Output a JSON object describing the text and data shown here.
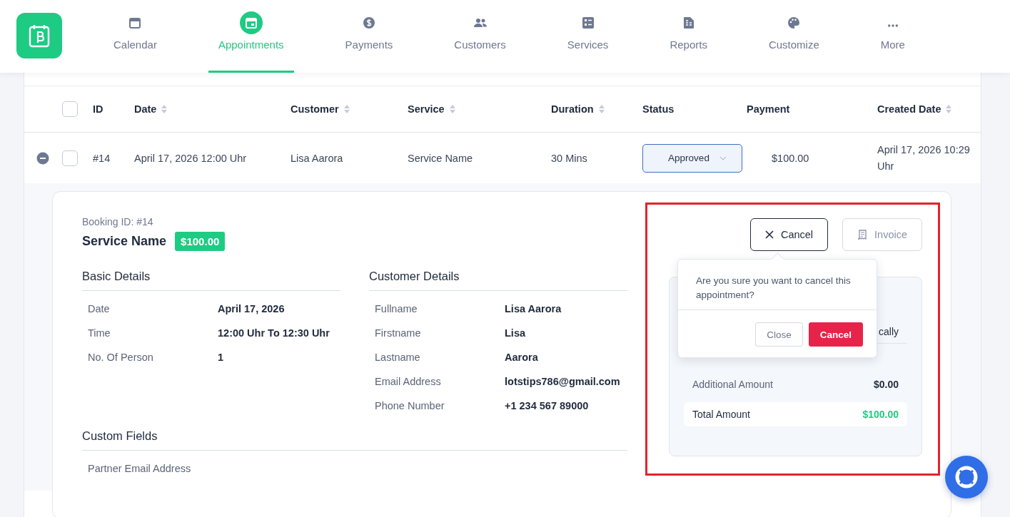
{
  "nav": {
    "items": [
      {
        "label": "Calendar",
        "selected": false
      },
      {
        "label": "Appointments",
        "selected": true
      },
      {
        "label": "Payments",
        "selected": false
      },
      {
        "label": "Customers",
        "selected": false
      },
      {
        "label": "Services",
        "selected": false
      },
      {
        "label": "Reports",
        "selected": false
      },
      {
        "label": "Customize",
        "selected": false
      },
      {
        "label": "More",
        "selected": false
      }
    ]
  },
  "table": {
    "select_all_checked": false,
    "columns": [
      {
        "label": "ID",
        "sortable": false
      },
      {
        "label": "Date",
        "sortable": true
      },
      {
        "label": "Customer",
        "sortable": true
      },
      {
        "label": "Service",
        "sortable": true
      },
      {
        "label": "Duration",
        "sortable": true
      },
      {
        "label": "Status",
        "sortable": false
      },
      {
        "label": "Payment",
        "sortable": false
      },
      {
        "label": "Created Date",
        "sortable": true
      }
    ],
    "rows": [
      {
        "expanded": true,
        "checked": false,
        "cells": [
          "#14",
          "April 17, 2026 12:00 Uhr",
          "Lisa Aarora",
          "Service Name",
          "30 Mins"
        ],
        "status": "Approved",
        "payment": "$100.00",
        "created": "April 17, 2026 10:29 Uhr"
      }
    ]
  },
  "details": {
    "booking_id": "Booking ID: #14",
    "service": "Service Name",
    "price": "$100.00",
    "sections": [
      {
        "title": "Basic Details",
        "rows": [
          {
            "label": "Date",
            "value": "April 17, 2026"
          },
          {
            "label": "Time",
            "value": "12:00 Uhr To 12:30 Uhr"
          },
          {
            "label": "No. Of Person",
            "value": "1"
          }
        ]
      },
      {
        "title": "Customer Details",
        "rows": [
          {
            "label": "Fullname",
            "value": "Lisa Aarora"
          },
          {
            "label": "Firstname",
            "value": "Lisa"
          },
          {
            "label": "Lastname",
            "value": "Aarora"
          },
          {
            "label": "Email Address",
            "value": "lotstips786@gmail.com"
          },
          {
            "label": "Phone Number",
            "value": "+1 234 567 89000"
          }
        ]
      }
    ],
    "custom_fields": {
      "title": "Custom Fields",
      "rows": [
        {
          "label": "Partner Email Address"
        }
      ]
    }
  },
  "actions": [
    {
      "label": "Cancel",
      "kind": "outline"
    },
    {
      "label": "Invoice",
      "kind": "muted"
    }
  ],
  "summary": {
    "fragment": "cally",
    "rows": [
      {
        "label": "Additional Amount",
        "value": "$0.00",
        "kind": "plain"
      },
      {
        "label": "Total Amount",
        "value": "$100.00",
        "kind": "total"
      }
    ]
  },
  "popover": {
    "message": "Are you sure you want to cancel this appointment?",
    "buttons": [
      {
        "label": "Close",
        "kind": "secondary"
      },
      {
        "label": "Cancel",
        "kind": "danger"
      }
    ]
  }
}
